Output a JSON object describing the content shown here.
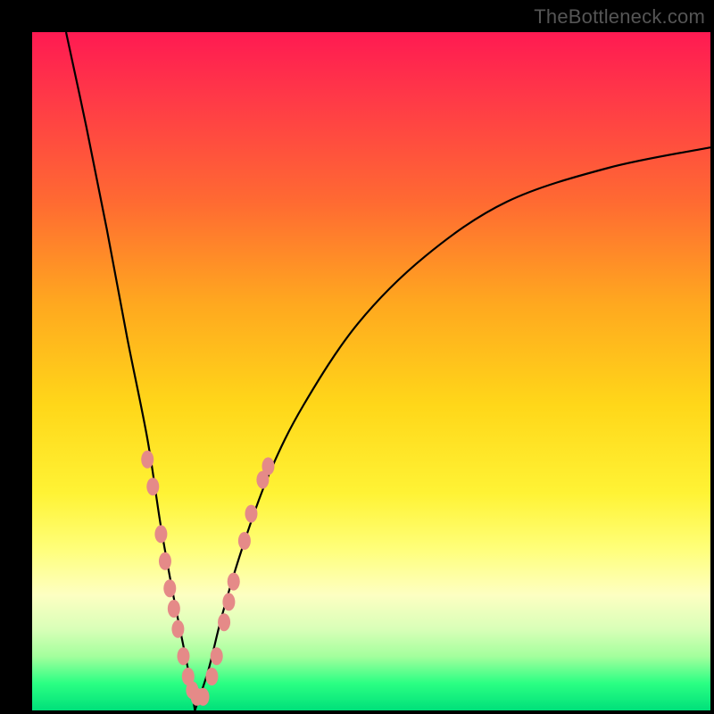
{
  "attribution": "TheBottleneck.com",
  "colors": {
    "background": "#000000",
    "curve_stroke": "#000000",
    "marker_fill": "#e58a88",
    "gradient_top": "#ff1a52",
    "gradient_bottom": "#00e07a"
  },
  "chart_data": {
    "type": "line",
    "title": "",
    "xlabel": "",
    "ylabel": "",
    "xlim": [
      0,
      100
    ],
    "ylim": [
      0,
      100
    ],
    "note": "V-shaped bottleneck curve with minimum near x≈24; y-axis is implied bottleneck % (0 at bottom, 100 at top). Values estimated from gradient position.",
    "series": [
      {
        "name": "left-branch",
        "x": [
          5,
          8,
          11,
          14,
          17,
          19,
          21,
          23,
          24
        ],
        "y": [
          100,
          86,
          71,
          55,
          40,
          27,
          16,
          6,
          0
        ]
      },
      {
        "name": "right-branch",
        "x": [
          24,
          26,
          28,
          31,
          35,
          40,
          48,
          58,
          70,
          85,
          100
        ],
        "y": [
          0,
          6,
          14,
          24,
          35,
          45,
          57,
          67,
          75,
          80,
          83
        ]
      }
    ],
    "markers": {
      "name": "highlighted-points",
      "note": "Pink bead-like markers clustered near the bottom of the V",
      "points": [
        {
          "x": 17.0,
          "y": 37
        },
        {
          "x": 17.8,
          "y": 33
        },
        {
          "x": 19.0,
          "y": 26
        },
        {
          "x": 19.6,
          "y": 22
        },
        {
          "x": 20.3,
          "y": 18
        },
        {
          "x": 20.9,
          "y": 15
        },
        {
          "x": 21.5,
          "y": 12
        },
        {
          "x": 22.3,
          "y": 8
        },
        {
          "x": 23.0,
          "y": 5
        },
        {
          "x": 23.6,
          "y": 3
        },
        {
          "x": 24.3,
          "y": 2
        },
        {
          "x": 25.2,
          "y": 2
        },
        {
          "x": 26.5,
          "y": 5
        },
        {
          "x": 27.2,
          "y": 8
        },
        {
          "x": 28.3,
          "y": 13
        },
        {
          "x": 29.0,
          "y": 16
        },
        {
          "x": 29.7,
          "y": 19
        },
        {
          "x": 31.3,
          "y": 25
        },
        {
          "x": 32.3,
          "y": 29
        },
        {
          "x": 34.0,
          "y": 34
        },
        {
          "x": 34.8,
          "y": 36
        }
      ]
    }
  }
}
